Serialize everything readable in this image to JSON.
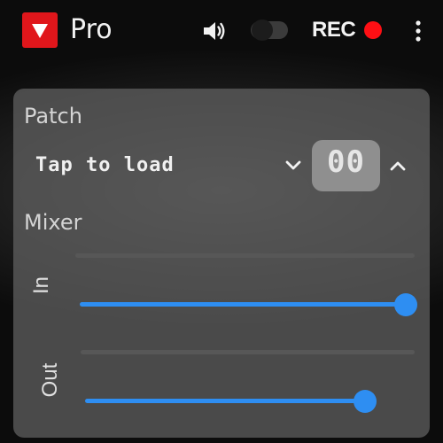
{
  "app": {
    "title": "Pro",
    "brand_color": "#e0161b"
  },
  "topbar": {
    "speaker_icon": "speaker-icon",
    "monitor_toggle": {
      "on": false
    },
    "rec_label": "REC",
    "rec_color": "#ff0f14",
    "menu_icon": "more-vert-icon"
  },
  "patch": {
    "label": "Patch",
    "name": "Tap to load",
    "number": "00",
    "prev_icon": "chevron-down-icon",
    "next_icon": "chevron-up-icon"
  },
  "mixer": {
    "label": "Mixer",
    "accent": "#2e8ef2",
    "channels": [
      {
        "label": "In",
        "level": 0.99
      },
      {
        "label": "Out",
        "level": 0.86
      }
    ]
  }
}
